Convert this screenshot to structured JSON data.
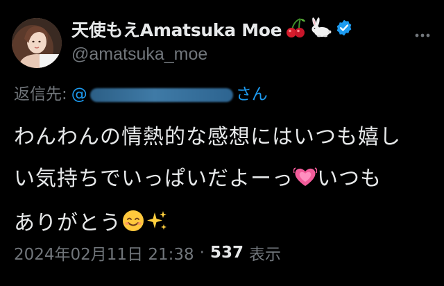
{
  "tweet": {
    "display_name": "天使もえAmatsuka Moe",
    "handle": "@amatsuka_moe",
    "reply_prefix": "返信先:",
    "reply_to_handle_start": "@",
    "reply_to_handle_end": "さん",
    "body_lines": [
      "わんわんの情熱的な感想にはいつも嬉し",
      "い気持ちでいっぱいだよーっ",
      "いつも",
      "ありがとう"
    ],
    "timestamp": "2024年02月11日 21:38",
    "separator": "·",
    "views_count": "537",
    "views_label": "表示"
  },
  "icons": {
    "name_emojis": [
      "cherries-icon",
      "rabbit-icon",
      "verified-badge-icon"
    ],
    "more": "more-options-icon",
    "heart": "growing-heart-emoji",
    "smile": "smiling-face-emoji",
    "sparkles": "sparkles-emoji"
  },
  "colors": {
    "background": "#000000",
    "text_primary": "#e7e9ea",
    "text_secondary": "#71767b",
    "link": "#1d9bf0",
    "verified": "#1d9bf0"
  }
}
